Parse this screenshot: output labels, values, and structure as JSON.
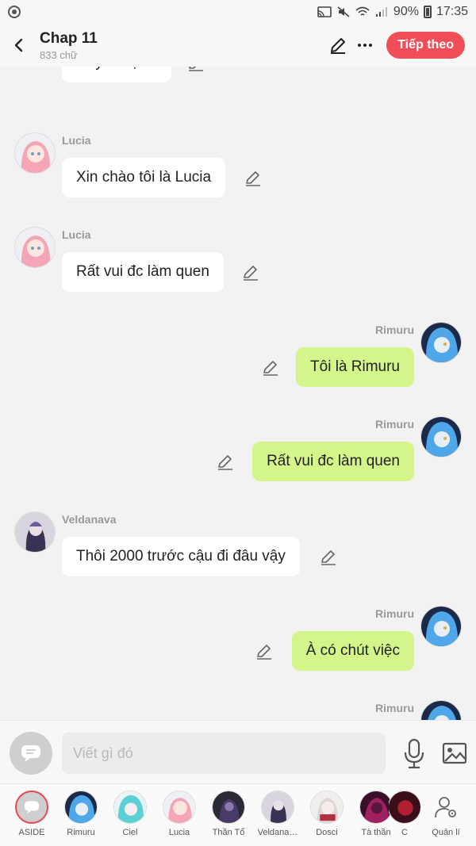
{
  "status_bar": {
    "battery": "90%",
    "time": "17:35"
  },
  "header": {
    "title": "Chap 11",
    "subtitle": "833 chữ",
    "next_label": "Tiếp theo"
  },
  "messages": [
    {
      "side": "left",
      "sender": "",
      "text": "Đây là vợ ta",
      "avatar": "veldanava"
    },
    {
      "side": "left",
      "sender": "Lucia",
      "text": "Xin chào tôi là Lucia",
      "avatar": "lucia"
    },
    {
      "side": "left",
      "sender": "Lucia",
      "text": "Rất vui đc làm quen",
      "avatar": "lucia"
    },
    {
      "side": "right",
      "sender": "Rimuru",
      "text": "Tôi là Rimuru",
      "avatar": "rimuru"
    },
    {
      "side": "right",
      "sender": "Rimuru",
      "text": "Rất vui đc làm quen",
      "avatar": "rimuru"
    },
    {
      "side": "left",
      "sender": "Veldanava",
      "text": "Thôi 2000 trước cậu đi đâu vậy",
      "avatar": "veldanava"
    },
    {
      "side": "right",
      "sender": "Rimuru",
      "text": "À có chút việc",
      "avatar": "rimuru"
    },
    {
      "side": "right",
      "sender": "Rimuru",
      "text": "",
      "avatar": "rimuru"
    }
  ],
  "input": {
    "placeholder": "Viết gì đó"
  },
  "characters": [
    {
      "name": "ASIDE",
      "avatar": "aside"
    },
    {
      "name": "Rimuru",
      "avatar": "rimuru"
    },
    {
      "name": "Ciel",
      "avatar": "ciel"
    },
    {
      "name": "Lucia",
      "avatar": "lucia"
    },
    {
      "name": "Thần Tổ",
      "avatar": "dark"
    },
    {
      "name": "Veldana…",
      "avatar": "veldanava"
    },
    {
      "name": "Dosci",
      "avatar": "dosci"
    },
    {
      "name": "Tà thần",
      "avatar": "tathan"
    },
    {
      "name": "C",
      "avatar": "tathan"
    },
    {
      "name": "Quản lí",
      "avatar": "manage"
    }
  ],
  "colors": {
    "accent": "#f24e58",
    "my_bubble": "#d4f58a",
    "other_bubble": "#ffffff"
  }
}
